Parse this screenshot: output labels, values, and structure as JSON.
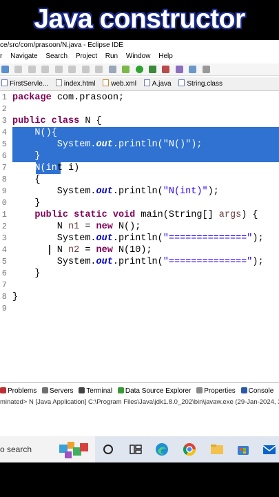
{
  "video_title": "Java constructor",
  "window": {
    "title": "ce/src/com/prasoon/N.java - Eclipse IDE"
  },
  "menu": [
    "r",
    "Navigate",
    "Search",
    "Project",
    "Run",
    "Window",
    "Help"
  ],
  "tabs": [
    {
      "label": "FirstServle...",
      "icon": "java-file-icon"
    },
    {
      "label": "index.html",
      "icon": "html-file-icon"
    },
    {
      "label": "web.xml",
      "icon": "xml-file-icon"
    },
    {
      "label": "A.java",
      "icon": "java-file-icon"
    },
    {
      "label": "String.class",
      "icon": "class-file-icon"
    }
  ],
  "code_lines": [
    {
      "n": "1",
      "code": "package com.prasoon;"
    },
    {
      "n": "2",
      "code": ""
    },
    {
      "n": "3",
      "code": "public class N {"
    },
    {
      "n": "4",
      "code": "    N(){"
    },
    {
      "n": "5",
      "code": "        System.out.println(\"N()\");"
    },
    {
      "n": "6",
      "code": "    }"
    },
    {
      "n": "7",
      "code": "    N(int i)"
    },
    {
      "n": "8",
      "code": "    {"
    },
    {
      "n": "9",
      "code": "        System.out.println(\"N(int)\");"
    },
    {
      "n": "0",
      "code": "    }"
    },
    {
      "n": "1",
      "code": "    public static void main(String[] args) {"
    },
    {
      "n": "2",
      "code": "        N n1 = new N();"
    },
    {
      "n": "3",
      "code": "        System.out.println(\"==============\");"
    },
    {
      "n": "4",
      "code": "        N n2 = new N(10);"
    },
    {
      "n": "5",
      "code": "        System.out.println(\"==============\");"
    },
    {
      "n": "6",
      "code": "    }"
    },
    {
      "n": "7",
      "code": ""
    },
    {
      "n": "8",
      "code": "}"
    },
    {
      "n": "9",
      "code": ""
    }
  ],
  "panel_tabs": [
    "Problems",
    "Servers",
    "Terminal",
    "Data Source Explorer",
    "Properties",
    "Console"
  ],
  "console_status": "minated> N [Java Application] C:\\Program Files\\Java\\jdk1.8.0_202\\bin\\javaw.exe  (29-Jan-2024, 3",
  "taskbar": {
    "search_text": "o search"
  },
  "colors": {
    "selection": "#2f72d2",
    "keyword": "#7f0055",
    "string": "#2a00ff",
    "field": "#0000c0"
  }
}
